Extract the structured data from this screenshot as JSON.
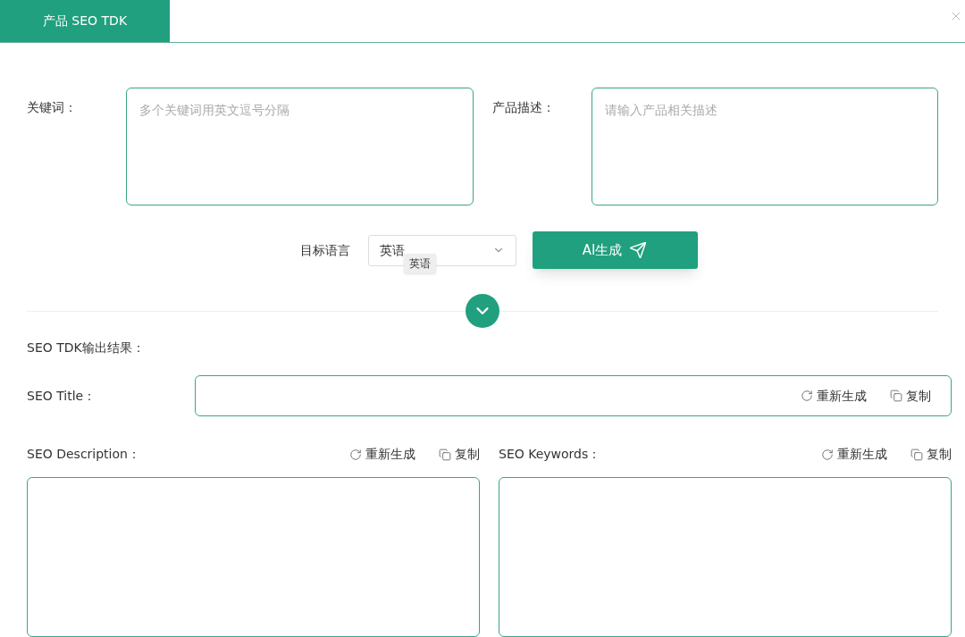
{
  "tab": {
    "label": "产品 SEO TDK",
    "selected": true
  },
  "inputs": [
    {
      "label": "关键词：",
      "placeholder": "多个关键词用英文逗号分隔"
    },
    {
      "label": "产品描述：",
      "placeholder": "请输入产品相关描述"
    }
  ],
  "language": {
    "label": "目标语言",
    "value": "英语",
    "tooltip": "英语"
  },
  "generate_button": {
    "label": "AI生成"
  },
  "results": {
    "heading": "SEO TDK输出结果：",
    "title": {
      "label": "SEO Title：",
      "actions": [
        {
          "kind": "regenerate",
          "label": "重新生成"
        },
        {
          "kind": "copy",
          "label": "复制"
        }
      ]
    },
    "fields": [
      {
        "label": "SEO Description：",
        "actions": [
          {
            "kind": "regenerate",
            "label": "重新生成"
          },
          {
            "kind": "copy",
            "label": "复制"
          }
        ]
      },
      {
        "label": "SEO Keywords：",
        "actions": [
          {
            "kind": "regenerate",
            "label": "重新生成"
          },
          {
            "kind": "copy",
            "label": "复制"
          }
        ]
      }
    ]
  }
}
